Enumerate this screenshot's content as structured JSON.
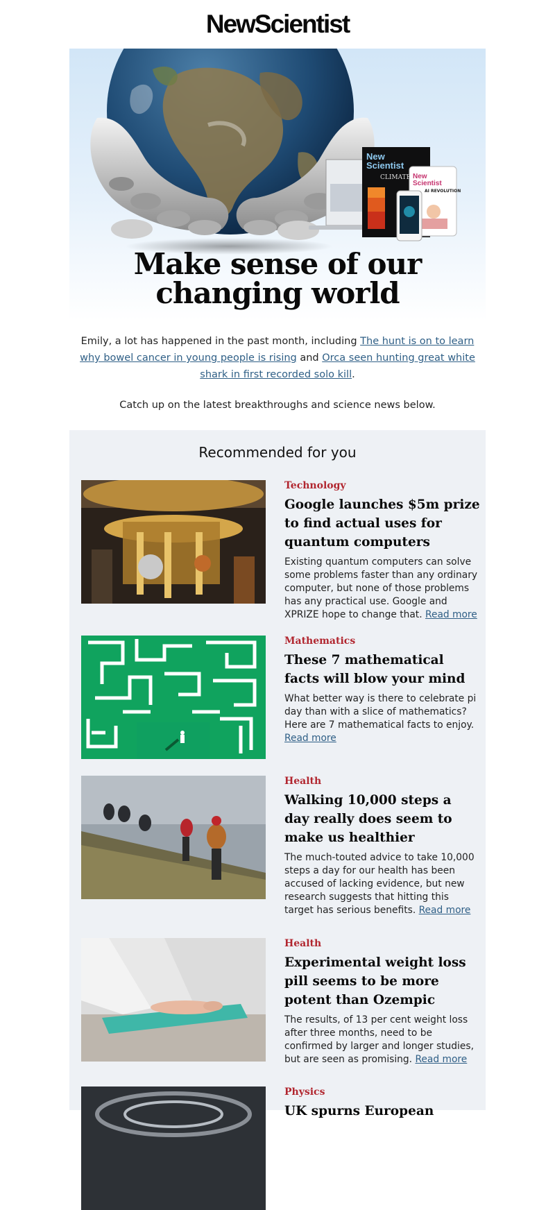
{
  "brand": {
    "logo_text": "NewScientist"
  },
  "hero": {
    "title_line1": "Make sense of our",
    "title_line2": "changing world",
    "mag_brand_1": "New",
    "mag_brand_2": "Scientist",
    "mag_cover_text": "CLIMATE CHANGE",
    "tablet_brand_1": "New",
    "tablet_brand_2": "Scientist",
    "tablet_cover_text": "AI REVOLUTION"
  },
  "intro": {
    "lead": "Emily, a lot has happened in the past month, including ",
    "link1": "The hunt is on to learn why bowel cancer in young people is rising",
    "middle": " and ",
    "link2": "Orca seen hunting great white shark in first recorded solo kill",
    "end": ".",
    "catchup": "Catch up on the latest breakthroughs and science news below."
  },
  "recommended": {
    "title": "Recommended for you",
    "read_more": "Read more",
    "articles": [
      {
        "category": "Technology",
        "headline": "Google launches $5m prize to find actual uses for quantum computers",
        "description": "Existing quantum computers can solve some problems faster than any ordinary computer, but none of those problems has any practical use. Google and XPRIZE hope to change that."
      },
      {
        "category": "Mathematics",
        "headline": "These 7 mathematical facts will blow your mind",
        "description": "What better way is there to celebrate pi day than with a slice of mathematics? Here are 7 mathematical facts to enjoy."
      },
      {
        "category": "Health",
        "headline": "Walking 10,000 steps a day really does seem to make us healthier",
        "description": "The much-touted advice to take 10,000 steps a day for our health has been accused of lacking evidence, but new research suggests that hitting this target has serious benefits."
      },
      {
        "category": "Health",
        "headline": "Experimental weight loss pill seems to be more potent than Ozempic",
        "description": "The results, of 13 per cent weight loss after three months, need to be confirmed by larger and longer studies, but are seen as promising."
      },
      {
        "category": "Physics",
        "headline": "UK spurns European"
      }
    ]
  },
  "colors": {
    "category": "#b1262f",
    "link": "#2f5f86",
    "panel_bg": "#eef1f5"
  }
}
